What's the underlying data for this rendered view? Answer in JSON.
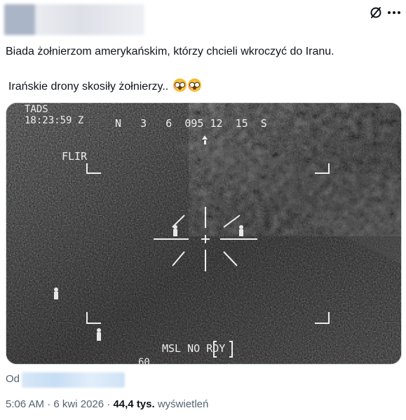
{
  "tweet": {
    "text_line1": "Biada żołnierzom amerykańskim, którzy chcieli wkroczyć do Iranu.",
    "text_line2": "Irańskie drony skosiły żołnierzy..",
    "emojis": [
      "flushed-face",
      "flushed-face"
    ]
  },
  "media": {
    "overlay": {
      "mode": "TADS",
      "time": "18:23:59 Z",
      "heading_tape": "N   3   6  095 12  15  S",
      "sensor": "FLIR",
      "weapon_status": "MSL NO RDY",
      "range": "60"
    }
  },
  "footer": {
    "from_label": "Od",
    "time": "5:06 AM",
    "separator": "·",
    "date": "6 kwi 2026",
    "views_count": "44,4 tys.",
    "views_label": "wyświetleń"
  },
  "icons": {
    "header_action": "no-entry-circle-icon",
    "more": "more-options-icon"
  }
}
